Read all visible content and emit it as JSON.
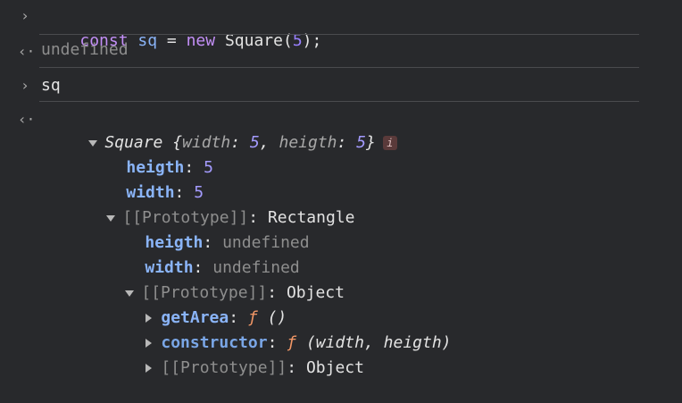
{
  "entries": [
    {
      "prompt": "›",
      "code": {
        "kw1": "const",
        "var": "sq",
        "eq": " = ",
        "kw2": "new",
        "cls": " Square(",
        "arg": "5",
        "end": ");"
      }
    },
    {
      "prompt": "‹·",
      "result": "undefined"
    },
    {
      "prompt": "›",
      "input": "sq"
    },
    {
      "prompt": "‹·"
    }
  ],
  "object": {
    "class_name": "Square",
    "preview_open": " {",
    "preview_key1": "width",
    "preview_val1": "5",
    "preview_key2": "heigth",
    "preview_val2": "5",
    "preview_close": "}",
    "info_badge": "i",
    "props": [
      {
        "key": "heigth",
        "value": "5"
      },
      {
        "key": "width",
        "value": "5"
      }
    ],
    "proto1": {
      "label": "[[Prototype]]",
      "value": "Rectangle",
      "props": [
        {
          "key": "heigth",
          "value": "undefined"
        },
        {
          "key": "width",
          "value": "undefined"
        }
      ]
    },
    "proto2": {
      "label": "[[Prototype]]",
      "value": "Object",
      "items": [
        {
          "key": "getArea",
          "f": "ƒ",
          "sig": " ()"
        },
        {
          "key": "constructor",
          "f": "ƒ",
          "sig": " (width, heigth)"
        }
      ],
      "proto3": {
        "label": "[[Prototype]]",
        "value": "Object"
      }
    }
  }
}
